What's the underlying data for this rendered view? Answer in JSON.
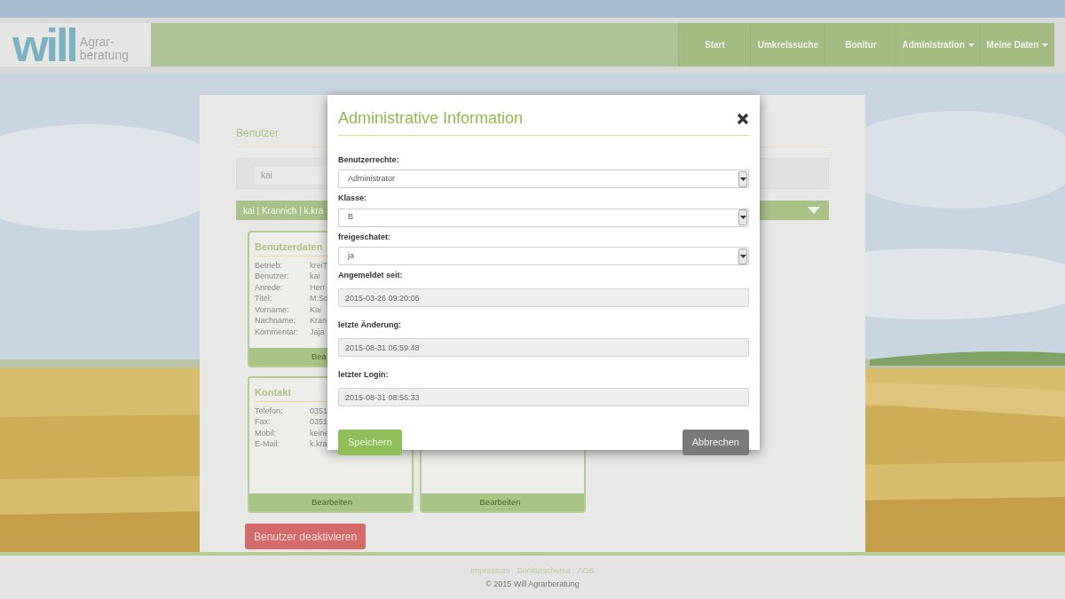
{
  "navbar": {
    "logo": {
      "word": "will",
      "tagline_1": "Agrar-",
      "tagline_2": "beratung"
    },
    "items": [
      {
        "label": "Start",
        "dropdown": false
      },
      {
        "label": "Umkreissuche",
        "dropdown": false
      },
      {
        "label": "Bonitur",
        "dropdown": false
      },
      {
        "label": "Administration",
        "dropdown": true
      },
      {
        "label": "Meine Daten",
        "dropdown": true
      }
    ]
  },
  "page": {
    "title": "Benutzer",
    "search": {
      "value": "kai"
    },
    "result_bar": {
      "label": "kai | Krannich | k.kra",
      "expanded": false
    },
    "cards": [
      {
        "title": "Benutzerdaten",
        "rows": [
          {
            "label": "Betrieb:",
            "value": "kreiT"
          },
          {
            "label": "Benutzer:",
            "value": "kai"
          },
          {
            "label": "Anrede:",
            "value": "Herr"
          },
          {
            "label": "Titel:",
            "value": "M.Sc"
          },
          {
            "label": "Vorname:",
            "value": "Kai"
          },
          {
            "label": "Nachname:",
            "value": "Kran"
          },
          {
            "label": "Kommentar:",
            "value": "Jaja"
          }
        ],
        "footer": "Bea"
      },
      {
        "title": "Kontakt",
        "rows": [
          {
            "label": "Telefon:",
            "value": "0351"
          },
          {
            "label": "Fax:",
            "value": "0351"
          },
          {
            "label": "Mobil:",
            "value": "keine"
          },
          {
            "label": "E-Mail:",
            "value": "k.kra"
          }
        ],
        "footer": "Bearbeiten"
      },
      {
        "footer": "Bearbeiten"
      }
    ],
    "deactivate_button": "Benutzer deaktivieren"
  },
  "footer": {
    "links": [
      "Impressum",
      "Boniturschema",
      "AGB"
    ],
    "copyright": "© 2015 Will Agrarberatung"
  },
  "modal": {
    "title": "Administrative Information",
    "fields": [
      {
        "kind": "select",
        "label": "Benutzerrechte:",
        "value": "Administrator"
      },
      {
        "kind": "select",
        "label": "Klasse:",
        "value": "B"
      },
      {
        "kind": "select",
        "label": "freigeschatet:",
        "value": "ja"
      },
      {
        "kind": "readonly",
        "label": "Angemeldet seit:",
        "value": "2015-03-26 09:20:06"
      },
      {
        "kind": "readonly",
        "label": "letzte Änderung:",
        "value": "2015-08-31 06:59:48"
      },
      {
        "kind": "readonly",
        "label": "letzter Login:",
        "value": "2015-08-31 08:56:33"
      }
    ],
    "buttons": [
      {
        "label": "Speichern",
        "kind": "primary"
      },
      {
        "label": "Abbrechen",
        "kind": "secondary"
      }
    ]
  }
}
